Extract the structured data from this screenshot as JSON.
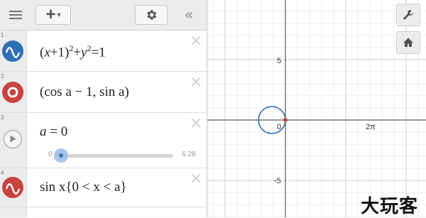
{
  "toolbar": {
    "menu_icon": "hamburger-icon",
    "add_label": "+",
    "add_caret": "▾",
    "settings_icon": "gear-icon",
    "collapse_label": "«"
  },
  "expressions": [
    {
      "number": "1",
      "icon": "wave-icon",
      "color": "#2d70b3",
      "latex_parts": [
        "(",
        "x",
        "+1)",
        "2",
        "+",
        "y",
        "2",
        "=1"
      ]
    },
    {
      "number": "2",
      "icon": "point-icon",
      "color": "#c74440",
      "latex_text": "(cos a − 1,  sin a)"
    },
    {
      "number": "3",
      "icon": "play-icon",
      "color": "#888888",
      "variable": "a",
      "equals": "= 0",
      "slider": {
        "min": "0",
        "max": "6.28",
        "value": 0
      }
    },
    {
      "number": "4",
      "icon": "wave-icon",
      "color": "#c74440",
      "latex_text": "sin x{0 < x < a}"
    }
  ],
  "graph": {
    "x_tick_labels": [
      "0",
      "2π"
    ],
    "y_tick_labels": [
      "5",
      "-5"
    ],
    "circle_color": "#2d70b3",
    "point_color": "#c74440"
  },
  "side_buttons": [
    "wrench-icon",
    "home-icon"
  ],
  "watermark": "大玩客"
}
